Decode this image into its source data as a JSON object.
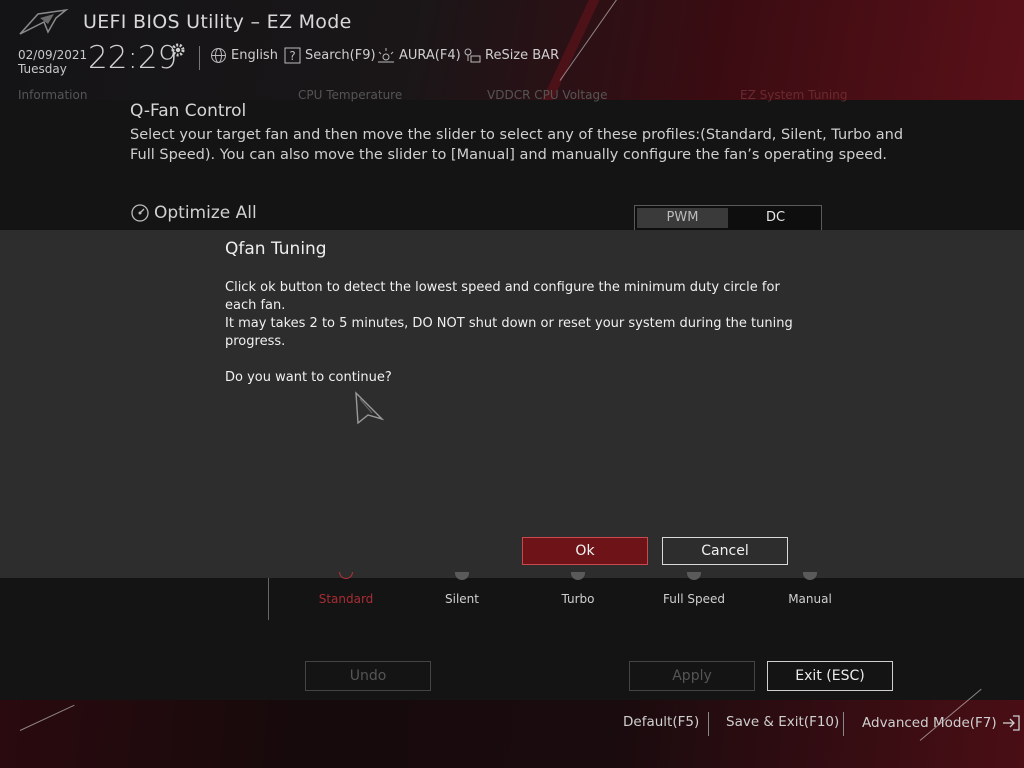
{
  "header": {
    "app_title": "UEFI BIOS Utility – EZ Mode",
    "date": "02/09/2021",
    "day": "Tuesday",
    "time": "22:29",
    "language": "English",
    "search": "Search(F9)",
    "aura": "AURA(F4)",
    "resize_bar": "ReSize BAR",
    "ghost_tabs": [
      "Information",
      "CPU Temperature",
      "VDDCR CPU Voltage",
      "EZ System Tuning"
    ]
  },
  "qfan": {
    "title": "Q-Fan Control",
    "description": "Select your target fan and then move the slider to select any of these profiles:(Standard, Silent, Turbo and Full Speed). You can also move the slider to [Manual] and manually configure the fan’s operating speed.",
    "optimize_all": "Optimize All",
    "mode_pwm": "PWM",
    "mode_dc": "DC",
    "profiles": [
      "Standard",
      "Silent",
      "Turbo",
      "Full Speed",
      "Manual"
    ],
    "active_profile": "Standard",
    "undo": "Undo",
    "apply": "Apply",
    "exit": "Exit (ESC)"
  },
  "dialog": {
    "title": "Qfan Tuning",
    "line1": "Click ok button to detect the lowest speed and configure the minimum duty circle for each fan.",
    "line2": "It may takes 2 to 5 minutes, DO NOT shut down or reset your system during the tuning progress.",
    "question": "Do you want to continue?",
    "ok": "Ok",
    "cancel": "Cancel"
  },
  "footer": {
    "default": "Default(F5)",
    "save_exit": "Save & Exit(F10)",
    "advanced": "Advanced Mode(F7)"
  },
  "colors": {
    "accent_red": "#6e1418",
    "active_profile": "#a72d33",
    "dialog_bg": "#2d2d2e"
  }
}
